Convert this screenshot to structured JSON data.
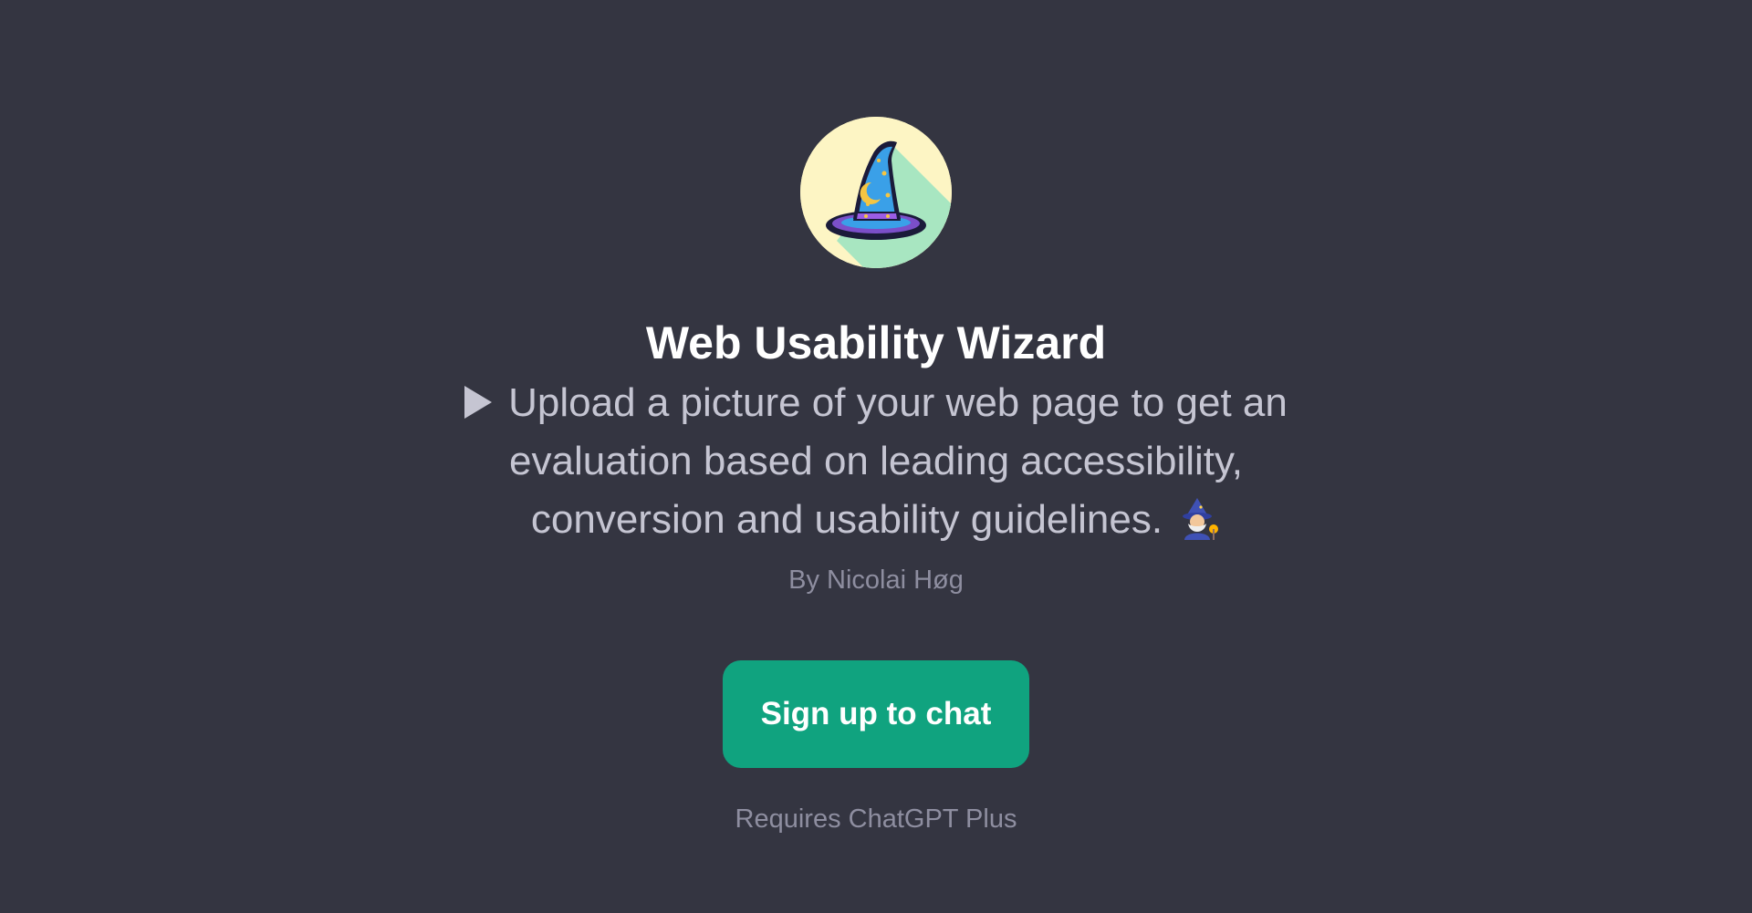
{
  "colors": {
    "background": "#343541",
    "title": "#ffffff",
    "description": "#c5c5d2",
    "muted": "#8e8ea0",
    "accent": "#10a37f"
  },
  "gpt": {
    "avatar_icon": "wizard-hat-icon",
    "title": "Web Usability Wizard",
    "description_lines": [
      "Upload a picture of your web page to get an",
      "evaluation based on leading accessibility,",
      "conversion and usability guidelines."
    ],
    "leading_icon": "play-icon",
    "trailing_icon": "wizard-emoji-icon",
    "author": "By Nicolai Høg"
  },
  "cta": {
    "label": "Sign up to chat"
  },
  "note": "Requires ChatGPT Plus"
}
